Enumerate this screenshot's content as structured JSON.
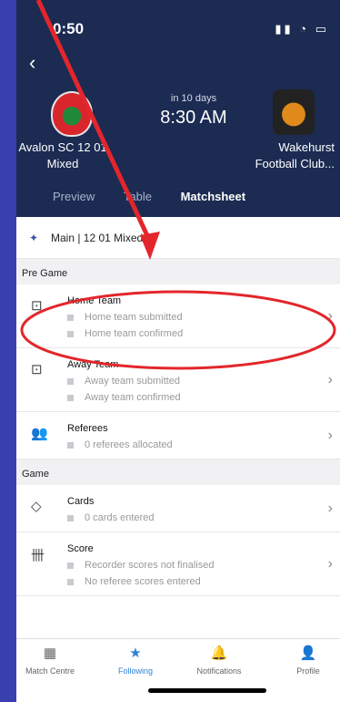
{
  "status": {
    "time": "0:50",
    "icons": "▮▮ ◔ ▭"
  },
  "header": {
    "back_icon": "‹",
    "kickoff_note": "in 10 days",
    "kickoff_time": "8:30 AM",
    "home_team": "Avalon SC 12 01 Mixed",
    "away_team": "Wakehurst Football Club...",
    "tabs": [
      {
        "label": "Preview"
      },
      {
        "label": "Table"
      },
      {
        "label": "Matchsheet"
      }
    ]
  },
  "competition": {
    "label": "Main | 12 01 Mixed"
  },
  "sections": {
    "pre_game": "Pre Game",
    "game": "Game"
  },
  "rows": {
    "home": {
      "title": "Home Team",
      "lines": [
        "Home team submitted",
        "Home team confirmed"
      ]
    },
    "away": {
      "title": "Away Team",
      "lines": [
        "Away team submitted",
        "Away team confirmed"
      ]
    },
    "referees": {
      "title": "Referees",
      "lines": [
        "0 referees allocated"
      ]
    },
    "cards": {
      "title": "Cards",
      "lines": [
        "0 cards entered"
      ]
    },
    "score": {
      "title": "Score",
      "lines": [
        "Recorder scores not finalised",
        "No referee scores entered"
      ]
    }
  },
  "tabbar": [
    {
      "label": "Match Centre",
      "icon": "grid-icon"
    },
    {
      "label": "Following",
      "icon": "star-icon"
    },
    {
      "label": "Notifications",
      "icon": "bell-icon"
    },
    {
      "label": "Profile",
      "icon": "person-icon"
    }
  ],
  "colors": {
    "header_bg": "#1b2b52",
    "accent": "#2f80d8",
    "annotation": "#e3262b",
    "backdrop": "#3a3fb0"
  }
}
